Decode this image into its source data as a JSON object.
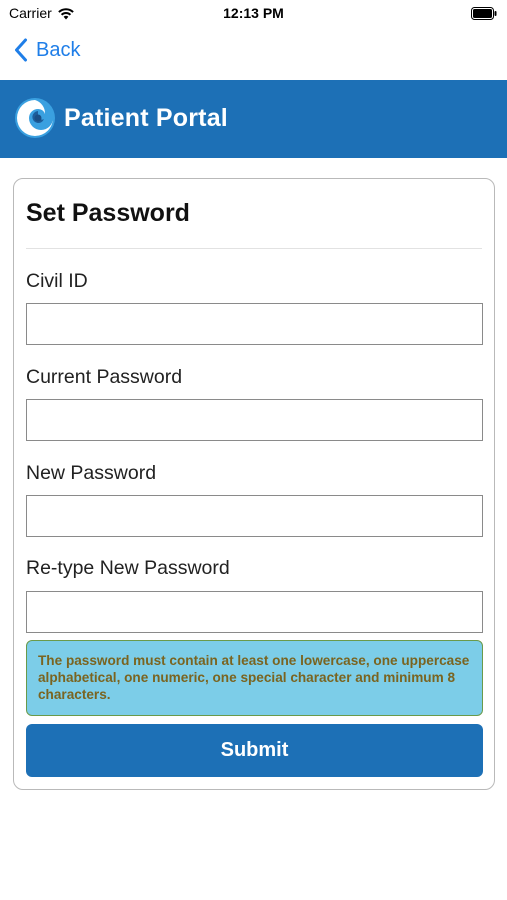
{
  "status_bar": {
    "carrier": "Carrier",
    "time": "12:13 PM",
    "icons": [
      "wifi-icon",
      "battery-icon"
    ]
  },
  "nav": {
    "back_label": "Back",
    "back_icon": "chevron-left-icon",
    "accent_color": "#1f7ee8"
  },
  "header": {
    "title": "Patient Portal",
    "logo_icon": "portal-logo-icon",
    "background_color": "#1d70b6"
  },
  "form": {
    "title": "Set Password",
    "fields": [
      {
        "label": "Civil ID",
        "value": ""
      },
      {
        "label": "Current Password",
        "value": ""
      },
      {
        "label": "New Password",
        "value": ""
      },
      {
        "label": "Re-type New Password",
        "value": ""
      }
    ],
    "hint": "The password must contain at least one lowercase, one uppercase alphabetical, one numeric, one special character and minimum 8 characters.",
    "hint_background": "#7ccde8",
    "submit_label": "Submit"
  }
}
